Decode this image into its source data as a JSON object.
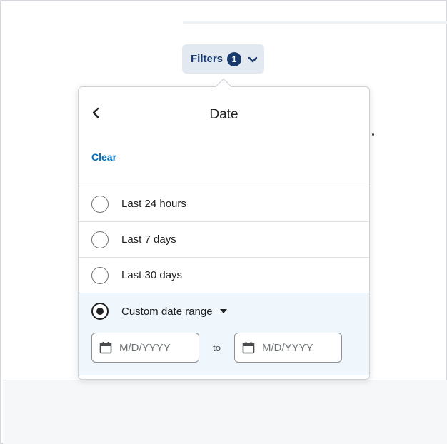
{
  "filters_button": {
    "label": "Filters",
    "count": "1"
  },
  "popover": {
    "title": "Date",
    "clear_label": "Clear",
    "options": [
      {
        "label": "Last 24 hours",
        "selected": false
      },
      {
        "label": "Last 7 days",
        "selected": false
      },
      {
        "label": "Last 30 days",
        "selected": false
      }
    ],
    "custom_option": {
      "label": "Custom date range",
      "selected": true
    },
    "date_range": {
      "start_placeholder": "M/D/YYYY",
      "separator": "to",
      "end_placeholder": "M/D/YYYY"
    }
  },
  "icons": {
    "back": "chevron-left-icon",
    "filters_toggle": "chevron-down-icon",
    "custom_toggle": "caret-down-icon",
    "date": "calendar-icon"
  },
  "colors": {
    "accent": "#006fbf",
    "filters_bg": "#e3e9f1",
    "filters_text": "#1a3b6e",
    "selected_row_bg": "#f0f7fc"
  }
}
